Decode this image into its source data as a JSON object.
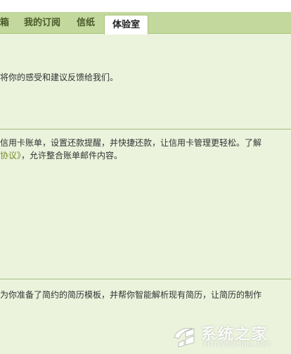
{
  "tabs": {
    "items": [
      {
        "label": "箱"
      },
      {
        "label": "我的订阅"
      },
      {
        "label": "信纸"
      }
    ],
    "active_label": "体验室"
  },
  "main": {
    "intro_text": "将你的感受和建议反馈给我们。",
    "credit_card": {
      "line1": "信用卡账单，设置还款提醒，并快捷还款，让信用卡管理更轻松。了解",
      "link_text": "协议》",
      "line2_rest": "，允许整合账单邮件内容。"
    },
    "resume_text": "为你准备了简约的简历模板，并帮你智能解析现有简历，让简历的制作"
  },
  "watermark": {
    "brand": "系统之家",
    "url": "XITONGZHIJIA.NET",
    "icon": "windows-logo-icon"
  }
}
